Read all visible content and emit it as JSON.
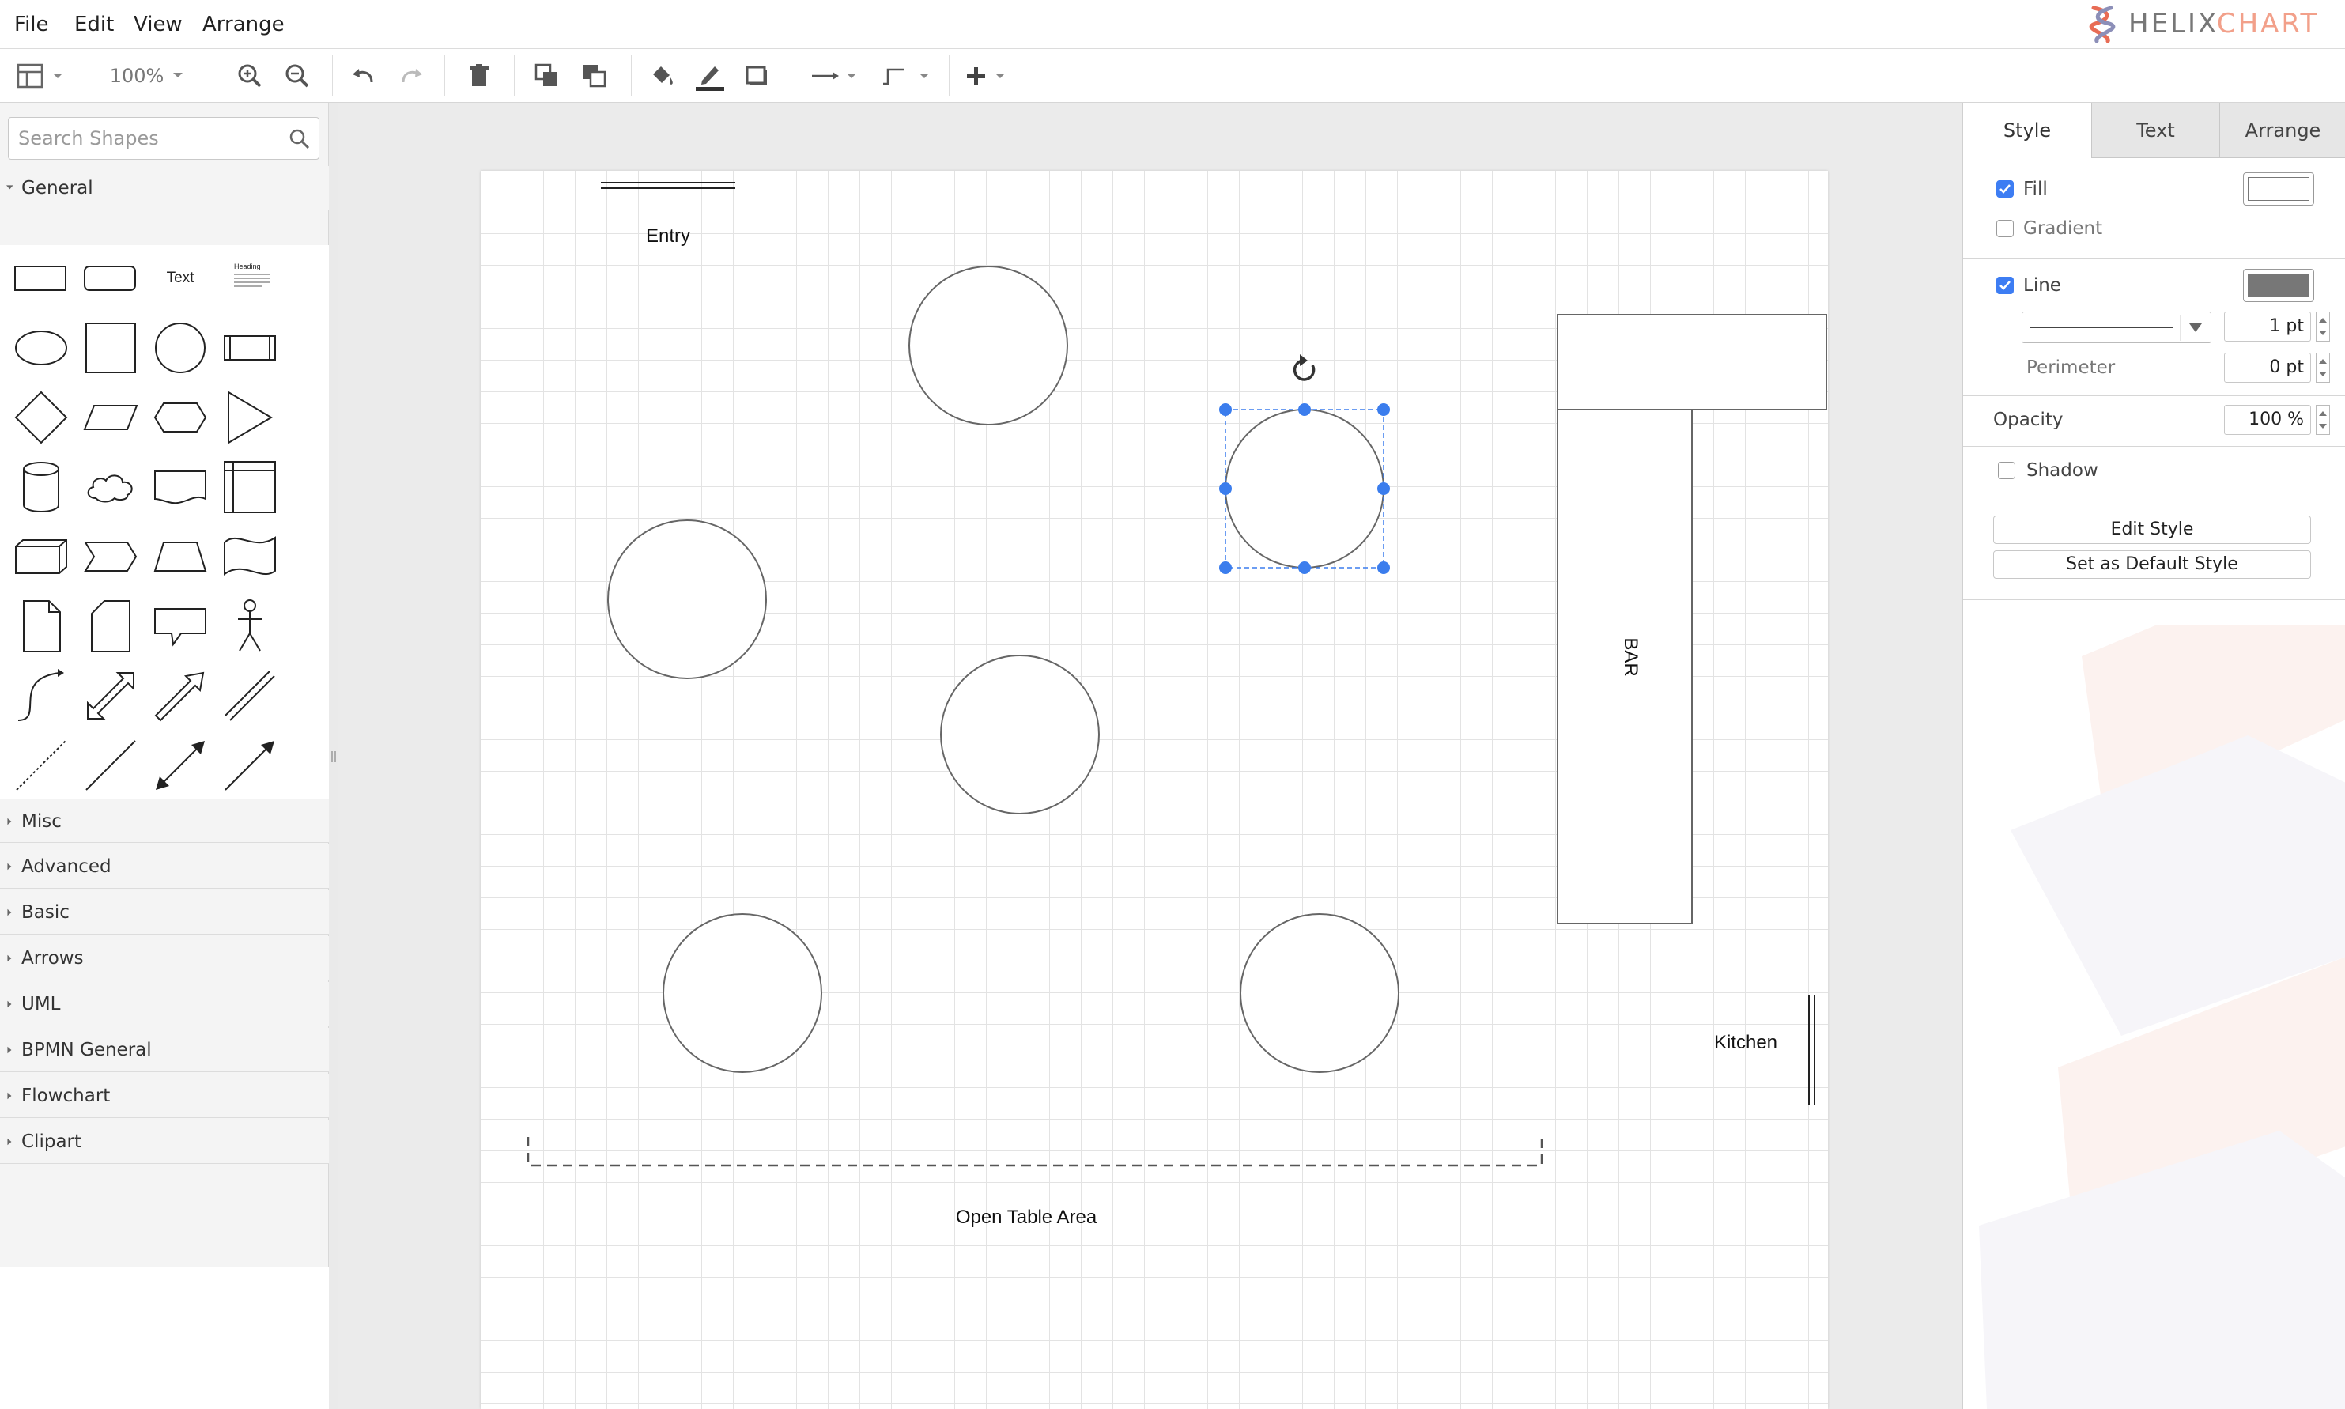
{
  "app": {
    "brand_a": "HELIX",
    "brand_b": "CHART"
  },
  "menu": [
    {
      "label": "File"
    },
    {
      "label": "Edit"
    },
    {
      "label": "View"
    },
    {
      "label": "Arrange"
    }
  ],
  "toolbar": {
    "zoom": "100%"
  },
  "sidebar": {
    "search_placeholder": "Search Shapes",
    "general_label": "General",
    "palette_text_label": "Text",
    "palette_heading_label": "Heading",
    "sections": [
      {
        "label": "Misc"
      },
      {
        "label": "Advanced"
      },
      {
        "label": "Basic"
      },
      {
        "label": "Arrows"
      },
      {
        "label": "UML"
      },
      {
        "label": "BPMN General"
      },
      {
        "label": "Flowchart"
      },
      {
        "label": "Clipart"
      }
    ]
  },
  "diagram": {
    "labels": {
      "entry": "Entry",
      "bar": "BAR",
      "kitchen": "Kitchen",
      "open_area": "Open Table Area"
    },
    "table_count": 6,
    "selected_shape": "ellipse",
    "selection_color": "#3b7ded"
  },
  "format_panel": {
    "tabs": [
      {
        "label": "Style"
      },
      {
        "label": "Text"
      },
      {
        "label": "Arrange"
      }
    ],
    "active_tab": "Style",
    "fill_label": "Fill",
    "fill_checked": true,
    "fill_color": "#ffffff",
    "gradient_label": "Gradient",
    "gradient_checked": false,
    "line_label": "Line",
    "line_checked": true,
    "line_color": "#777777",
    "line_width": "1 pt",
    "perimeter_label": "Perimeter",
    "perimeter_value": "0 pt",
    "opacity_label": "Opacity",
    "opacity_value": "100 %",
    "shadow_label": "Shadow",
    "shadow_checked": false,
    "edit_style_button": "Edit Style",
    "default_style_button": "Set as Default Style"
  }
}
